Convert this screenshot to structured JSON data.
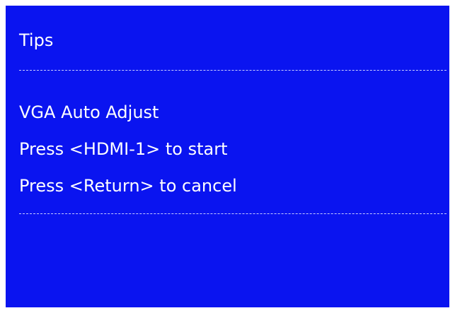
{
  "dialog": {
    "title": "Tips",
    "lines": [
      "VGA Auto Adjust",
      "Press <HDMI-1> to start",
      "Press <Return> to cancel"
    ]
  },
  "colors": {
    "background": "#0a14f0",
    "text": "#ffffff",
    "frame": "#ffffff"
  }
}
